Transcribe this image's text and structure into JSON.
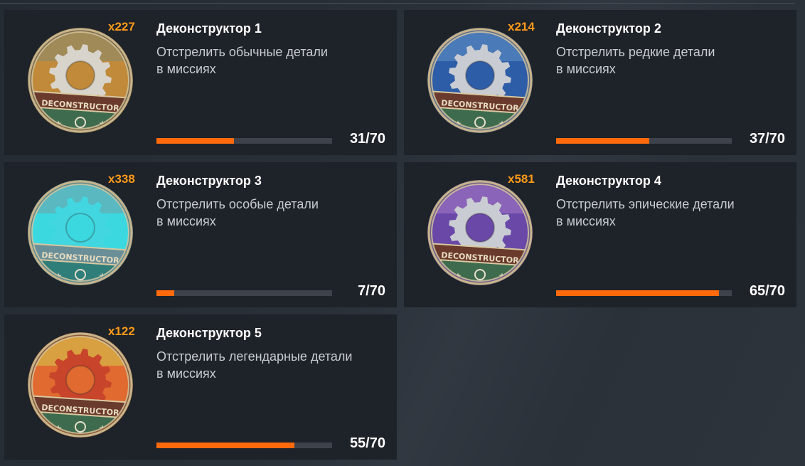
{
  "cards": [
    {
      "count": "x227",
      "title": "Деконструктор 1",
      "desc_line1": "Отстрелить обычные детали",
      "desc_line2": "в миссиях",
      "progress_text": "31/70",
      "progress": 0.443,
      "badge": {
        "top": "#a08a58",
        "mid": "#c08a3a",
        "gear": "#d8d4cc",
        "ring": "#7a6a4a",
        "bottom": "#3e6b4e",
        "banner": "#6a3a2c",
        "banner_text": "DECONSTRUCTOR"
      }
    },
    {
      "count": "x214",
      "title": "Деконструктор 2",
      "desc_line1": "Отстрелить редкие детали",
      "desc_line2": "в миссиях",
      "progress_text": "37/70",
      "progress": 0.529,
      "badge": {
        "top": "#4a7ab8",
        "mid": "#2e5da8",
        "gear": "#c9ccd2",
        "ring": "#5f6f8a",
        "bottom": "#3e6b4e",
        "banner": "#6a3a2c",
        "banner_text": "DECONSTRUCTOR"
      }
    },
    {
      "count": "x338",
      "title": "Деконструктор 3",
      "desc_line1": "Отстрелить особые детали",
      "desc_line2": "в миссиях",
      "progress_text": "7/70",
      "progress": 0.1,
      "badge": {
        "top": "#5ab8c0",
        "mid": "#3cd8e0",
        "gear": "#42d6e0",
        "ring": "#5a8a90",
        "bottom": "#2f7e7a",
        "banner": "#6a8f98",
        "banner_text": "DECONSTRUCTOR"
      }
    },
    {
      "count": "x581",
      "title": "Деконструктор 4",
      "desc_line1": "Отстрелить эпические детали",
      "desc_line2": "в миссиях",
      "progress_text": "65/70",
      "progress": 0.929,
      "badge": {
        "top": "#8a64b8",
        "mid": "#6a48a8",
        "gear": "#c9ccd2",
        "ring": "#6f5f8a",
        "bottom": "#3e6b4e",
        "banner": "#6a3a2c",
        "banner_text": "DECONSTRUCTOR"
      }
    },
    {
      "count": "x122",
      "title": "Деконструктор 5",
      "desc_line1": "Отстрелить легендарные детали",
      "desc_line2": "в миссиях",
      "progress_text": "55/70",
      "progress": 0.786,
      "badge": {
        "top": "#d8a040",
        "mid": "#e06a30",
        "gear": "#c8442a",
        "ring": "#8a5a3a",
        "bottom": "#3e6b4e",
        "banner": "#6a3a2c",
        "banner_text": "DECONSTRUCTOR"
      }
    }
  ]
}
